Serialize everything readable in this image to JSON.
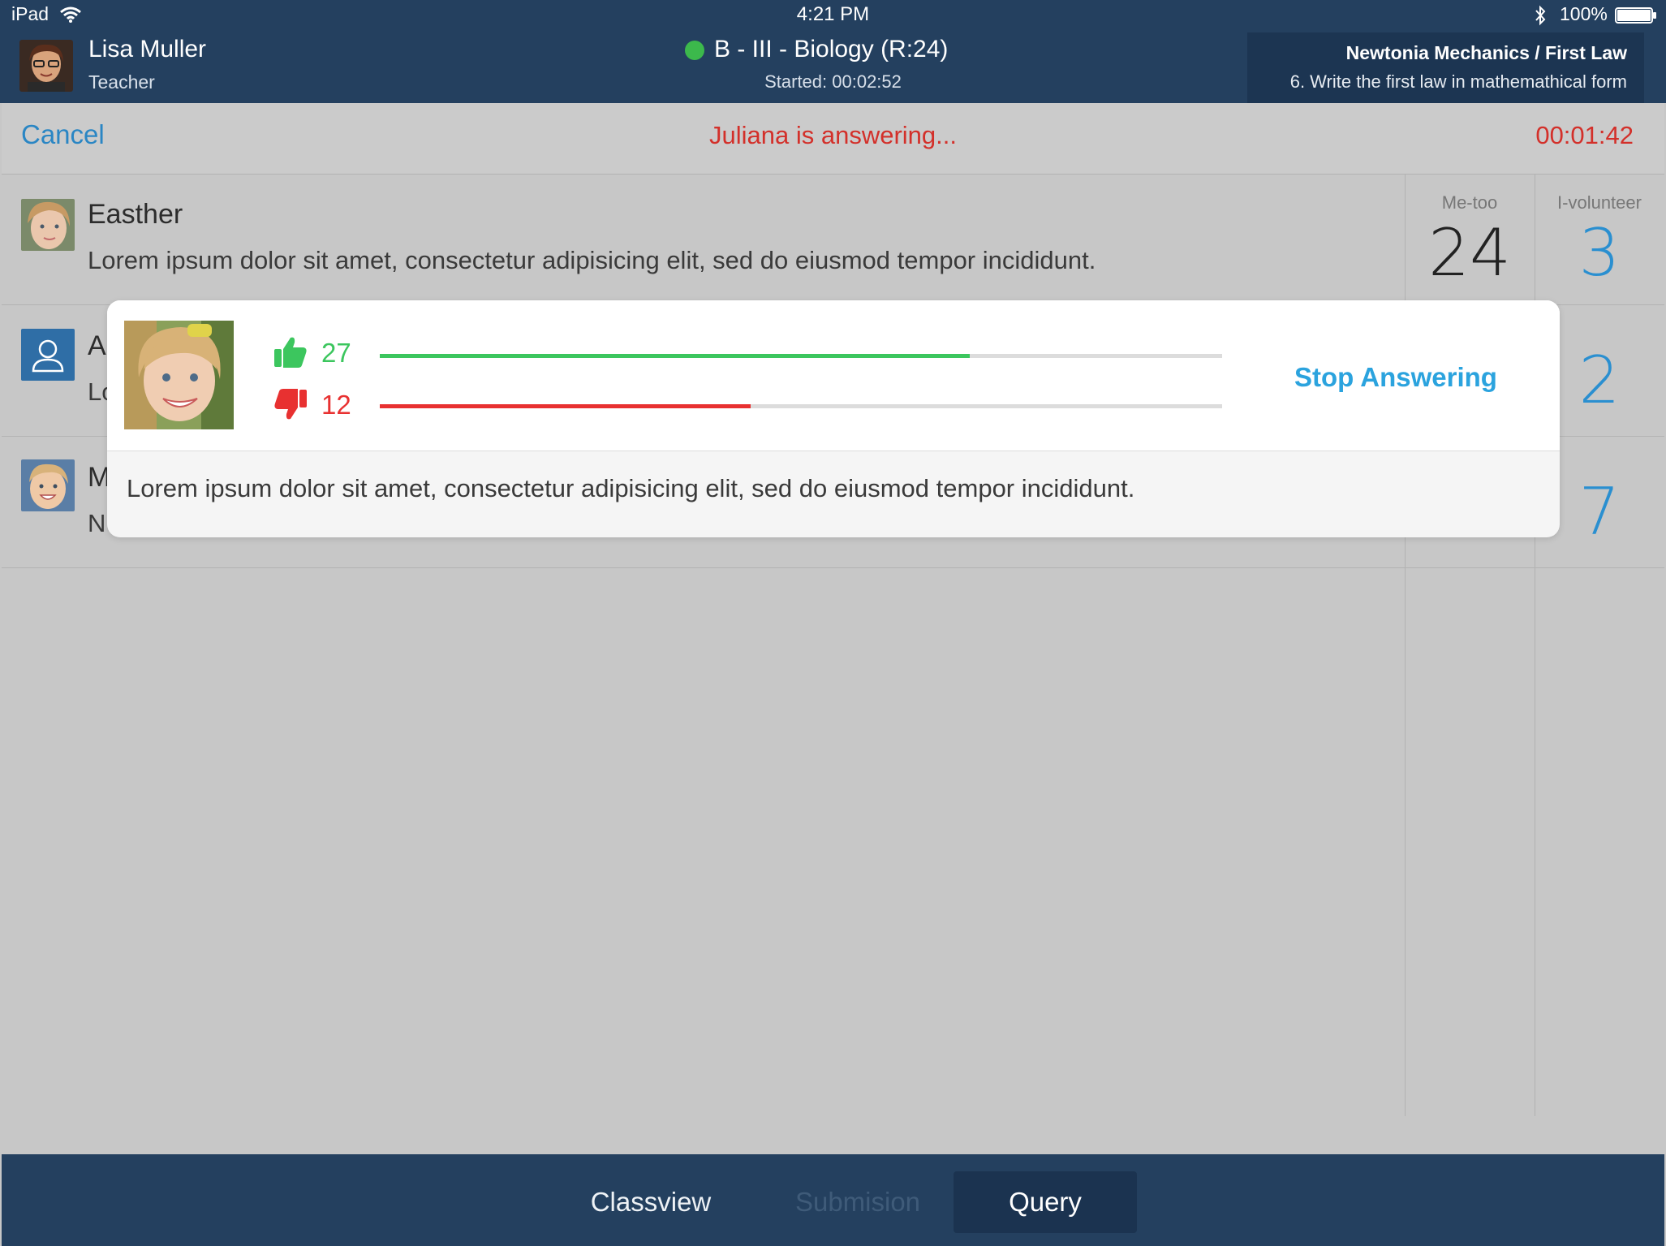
{
  "status_bar": {
    "carrier": "iPad",
    "time": "4:21 PM",
    "battery": "100%",
    "battery_level": 1.0
  },
  "teacher": {
    "name": "Lisa Muller",
    "role": "Teacher"
  },
  "class": {
    "title": "B - III - Biology (R:24)",
    "started": "Started: 00:02:52",
    "status_color": "#3cb94c"
  },
  "lesson": {
    "title": "Newtonia Mechanics / First Law",
    "question": "6. Write the first law in mathemathical form"
  },
  "action_bar": {
    "cancel_label": "Cancel",
    "status": "Juliana is answering...",
    "timer": "00:01:42"
  },
  "columns": {
    "metoo_label": "Me-too",
    "volunteer_label": "I-volunteer"
  },
  "rows": [
    {
      "name": "Easther",
      "text": "Lorem ipsum dolor sit amet, consectetur adipisicing elit, sed do eiusmod tempor incididunt.",
      "metoo": "24",
      "volunteer": "3",
      "avatar": "student-photo"
    },
    {
      "name": "A",
      "text": "Lo",
      "metoo": "",
      "volunteer": "2",
      "avatar": "person-placeholder-icon"
    },
    {
      "name": "M",
      "text": "N",
      "metoo": "",
      "volunteer": "7",
      "avatar": "student-photo"
    }
  ],
  "popup": {
    "up_votes": "27",
    "down_votes": "12",
    "up_fraction": 0.7,
    "down_fraction": 0.44,
    "stop_label": "Stop Answering",
    "answer_text": "Lorem ipsum dolor sit amet, consectetur adipisicing elit, sed do eiusmod tempor incididunt."
  },
  "tabs": {
    "classview": "Classview",
    "submission": "Submision",
    "query": "Query",
    "active": "Query"
  },
  "colors": {
    "header": "#24405f",
    "accent": "#2ba3de",
    "alert": "#d3302a",
    "positive": "#3cc65e",
    "negative": "#e83131"
  }
}
